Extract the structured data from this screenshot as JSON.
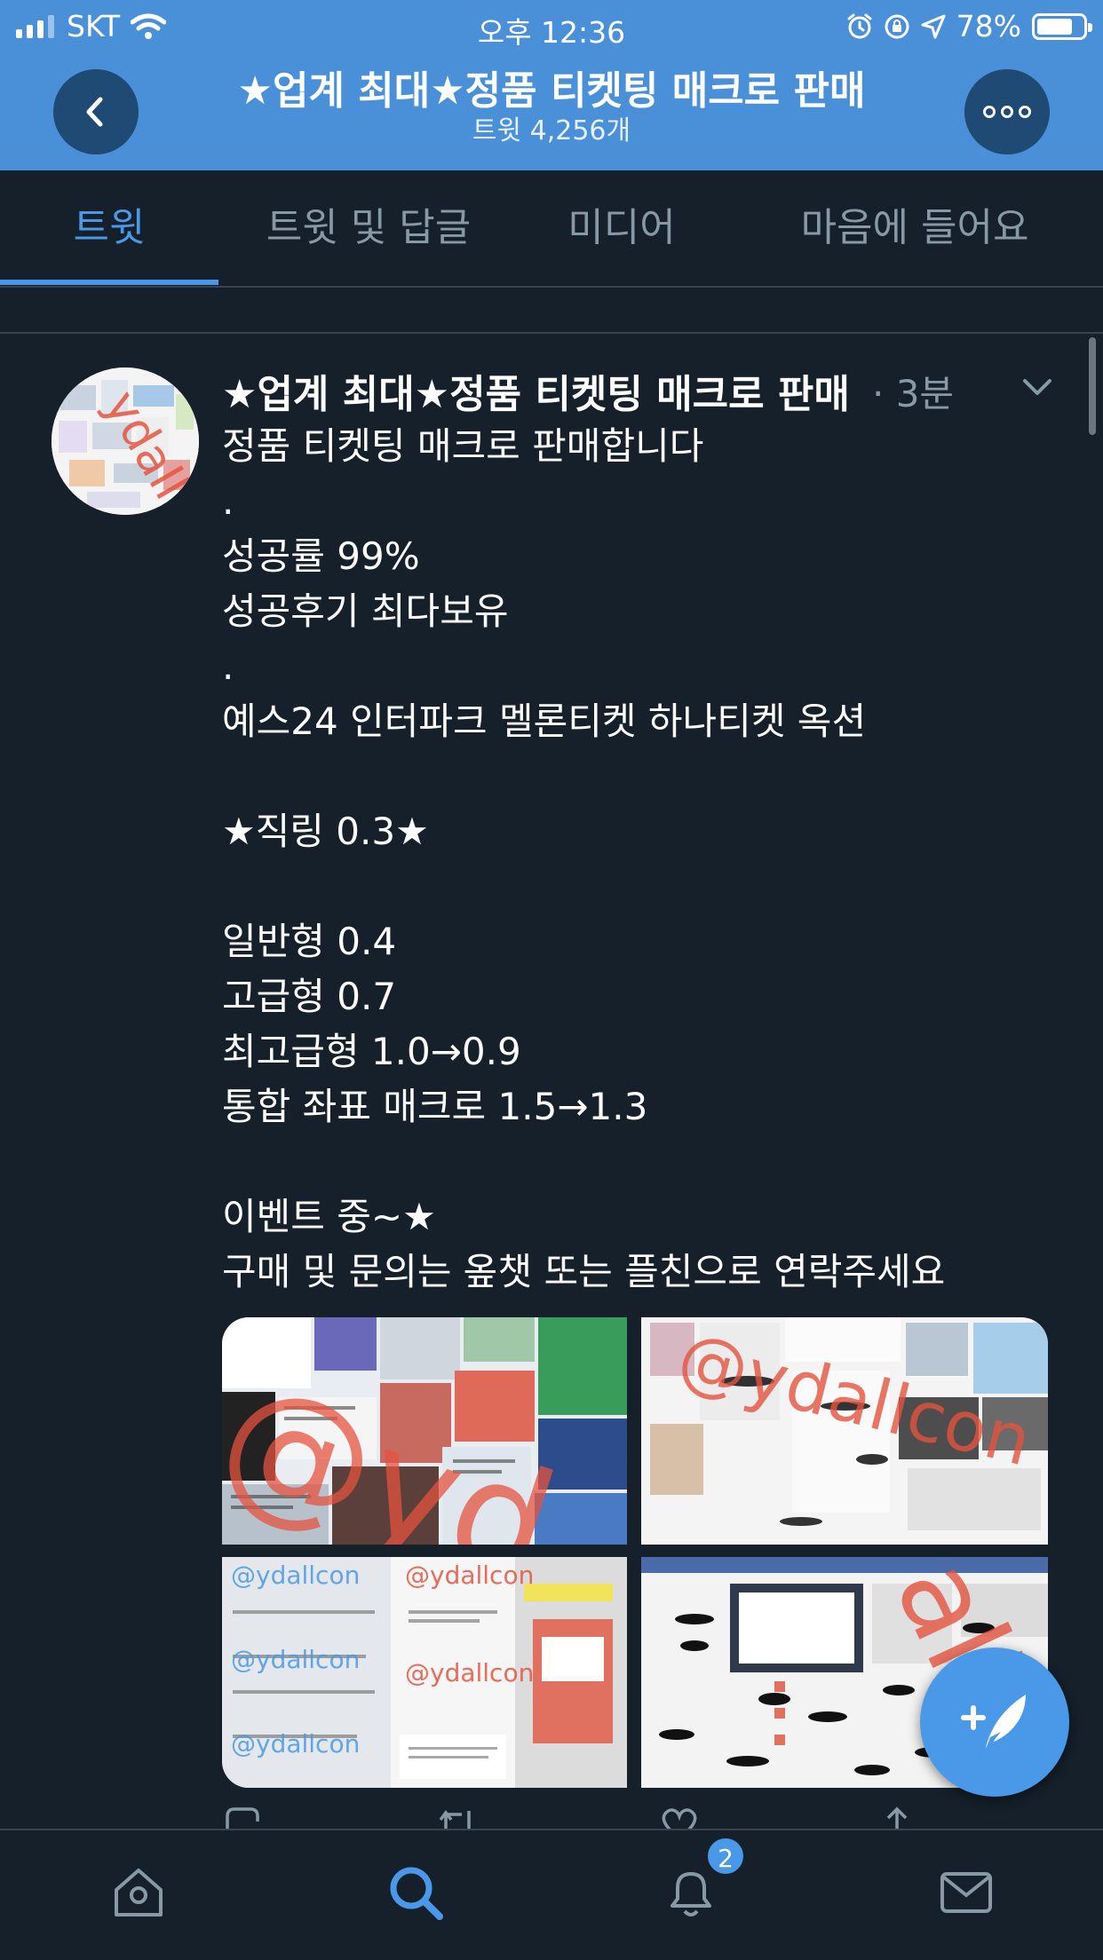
{
  "status_bar": {
    "carrier": "SKT",
    "time": "오후 12:36",
    "battery": "78%",
    "battery_level": 0.78
  },
  "header": {
    "title": "★업계 최대★정품 티켓팅 매크로 판매",
    "subtitle": "트윗 4,256개",
    "accent_color": "#4a90d9"
  },
  "tabs": [
    {
      "label": "트윗",
      "active": true
    },
    {
      "label": "트윗 및 답글",
      "active": false
    },
    {
      "label": "미디어",
      "active": false
    },
    {
      "label": "마음에 들어요",
      "active": false
    }
  ],
  "tweet": {
    "author": "★업계 최대★정품 티켓팅 매크로 판매",
    "time": "· 3분",
    "lines": [
      "정품 티켓팅 매크로 판매합니다",
      ".",
      "성공률 99%",
      "성공후기 최다보유",
      ".",
      "예스24 인터파크 멜론티켓 하나티켓 옥션",
      "",
      "★직링 0.3★",
      "",
      "일반형 0.4",
      "고급형 0.7",
      "최고급형 1.0→0.9",
      "통합 좌표 매크로 1.5→1.3",
      "",
      "이벤트 중~★",
      "구매 및 문의는 옾챗 또는 플친으로 연락주세요"
    ],
    "media": [
      {
        "watermark": "@yd"
      },
      {
        "watermark": "@ydallcon"
      },
      {
        "watermark": "@ydallcon"
      },
      {
        "watermark": "allc"
      }
    ]
  },
  "bottom_nav": {
    "items": [
      "home-icon",
      "search-icon",
      "bell-icon",
      "mail-icon"
    ],
    "active": "search-icon",
    "notification_badge": "2"
  },
  "colors": {
    "background": "#15202b",
    "accent": "#4a99e9",
    "muted": "#8899a6"
  }
}
